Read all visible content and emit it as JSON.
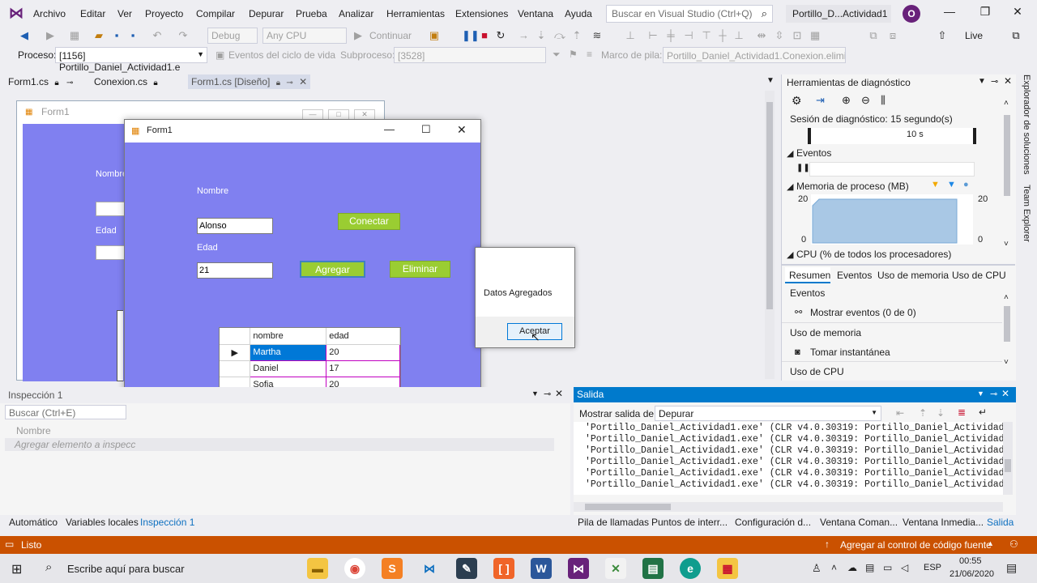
{
  "menu": {
    "items": [
      "Archivo",
      "Editar",
      "Ver",
      "Proyecto",
      "Compilar",
      "Depurar",
      "Prueba",
      "Analizar",
      "Herramientas",
      "Extensiones",
      "Ventana",
      "Ayuda"
    ],
    "search_placeholder": "Buscar en Visual Studio (Ctrl+Q)",
    "solution_title": "Portillo_D...Actividad1",
    "avatar_initial": "O"
  },
  "toolbar": {
    "config": "Debug",
    "platform": "Any CPU",
    "continue_label": "Continuar",
    "live_share": "Live Share"
  },
  "process_bar": {
    "proceso_label": "Proceso:",
    "proceso_value": "[1156] Portillo_Daniel_Actividad1.e",
    "eventos_label": "Eventos del ciclo de vida",
    "subproceso_label": "Subproceso:",
    "subproceso_value": "[3528]",
    "marco_label": "Marco de pila:",
    "marco_value": "Portillo_Daniel_Actividad1.Conexion.elimi"
  },
  "doc_tabs": [
    "Form1.cs",
    "Conexion.cs",
    "Form1.cs [Diseño]"
  ],
  "design_form": {
    "title": "Form1",
    "nombre_label": "Nombre",
    "edad_label": "Edad"
  },
  "form1": {
    "title": "Form1",
    "nombre_label": "Nombre",
    "nombre_value": "Alonso",
    "edad_label": "Edad",
    "edad_value": "21",
    "conectar": "Conectar",
    "agregar": "Agregar",
    "eliminar": "Eliminar",
    "grid": {
      "columns": [
        "nombre",
        "edad"
      ],
      "rows": [
        {
          "nombre": "Martha",
          "edad": "20"
        },
        {
          "nombre": "Daniel",
          "edad": "17"
        },
        {
          "nombre": "Sofia",
          "edad": "20"
        }
      ]
    }
  },
  "msgbox": {
    "message": "Datos Agregados",
    "ok": "Aceptar"
  },
  "diagnostics": {
    "title": "Herramientas de diagnóstico",
    "session": "Sesión de diagnóstico: 15 segundo(s)",
    "timeline_tick": "10 s",
    "eventos": "Eventos",
    "memoria": "Memoria de proceso (MB)",
    "mem_max": "20",
    "mem_min": "0",
    "cpu": "CPU (% de todos los procesadores)",
    "tabs": [
      "Resumen",
      "Eventos",
      "Uso de memoria",
      "Uso de CPU"
    ],
    "sec_eventos": "Eventos",
    "mostrar_eventos": "Mostrar eventos (0 de 0)",
    "sec_memoria": "Uso de memoria",
    "tomar": "Tomar instantánea",
    "sec_cpu": "Uso de CPU"
  },
  "sidebar": {
    "explorador": "Explorador de soluciones",
    "team": "Team Explorer"
  },
  "inspection": {
    "title": "Inspección 1",
    "search": "Buscar (Ctrl+E)",
    "col_nombre": "Nombre",
    "add_hint": "Agregar elemento a inspecc"
  },
  "output": {
    "title": "Salida",
    "show_from_label": "Mostrar salida de:",
    "show_from_value": "Depurar",
    "lines": [
      "'Portillo_Daniel_Actividad1.exe' (CLR v4.0.30319: Portillo_Daniel_Actividad1.e:",
      "'Portillo_Daniel_Actividad1.exe' (CLR v4.0.30319: Portillo_Daniel_Actividad1.e:",
      "'Portillo_Daniel_Actividad1.exe' (CLR v4.0.30319: Portillo_Daniel_Actividad1.e:",
      "'Portillo_Daniel_Actividad1.exe' (CLR v4.0.30319: Portillo_Daniel_Actividad1.e:",
      "'Portillo_Daniel_Actividad1.exe' (CLR v4.0.30319: Portillo_Daniel_Actividad1.e:",
      "'Portillo_Daniel_Actividad1.exe' (CLR v4.0.30319: Portillo_Daniel_Actividad1.e:"
    ]
  },
  "bottom_tabs_left": [
    "Automático",
    "Variables locales",
    "Inspección 1"
  ],
  "bottom_tabs_right": [
    "Pila de llamadas",
    "Puntos de interr...",
    "Configuración d...",
    "Ventana Coman...",
    "Ventana Inmedia...",
    "Salida"
  ],
  "status": {
    "listo": "Listo",
    "source_control": "Agregar al control de código fuente"
  },
  "taskbar": {
    "search": "Escribe aquí para buscar",
    "lang": "ESP",
    "time": "00:55",
    "date": "21/06/2020"
  }
}
